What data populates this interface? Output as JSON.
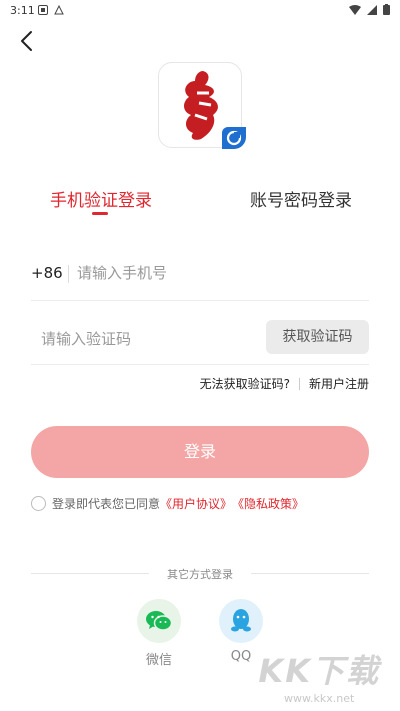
{
  "status_bar": {
    "time": "3:11"
  },
  "tabs": {
    "phone_login": "手机验证登录",
    "password_login": "账号密码登录"
  },
  "phone": {
    "prefix": "+86",
    "placeholder": "请输入手机号"
  },
  "code": {
    "placeholder": "请输入验证码",
    "get_code": "获取验证码"
  },
  "links": {
    "cant_get_code": "无法获取验证码?",
    "register": "新用户注册"
  },
  "login_button": "登录",
  "agreement": {
    "text": "登录即代表您已同意",
    "user_agreement": "《用户协议》",
    "privacy_policy": "《隐私政策》"
  },
  "other_login": {
    "label": "其它方式登录",
    "wechat": "微信",
    "qq": "QQ"
  },
  "watermark": {
    "brand": "KK下载",
    "url": "www.kkx.net"
  },
  "colors": {
    "accent": "#e0262e",
    "login_button": "#f4a6a6",
    "wechat": "#19b955",
    "qq": "#2aa4e0",
    "badge": "#1e6fd0"
  }
}
